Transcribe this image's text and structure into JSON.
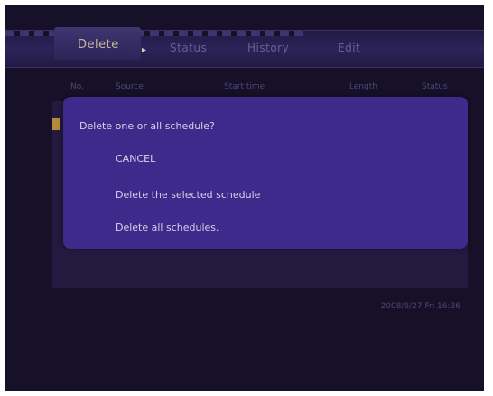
{
  "tabs": [
    {
      "label": "Delete",
      "active": true
    },
    {
      "label": "Status"
    },
    {
      "label": "History"
    },
    {
      "label": "Edit"
    }
  ],
  "columns": [
    "No.",
    "Source",
    "Start time",
    "Length",
    "Status"
  ],
  "dialog": {
    "title": "Delete one or all schedule?",
    "options": [
      "CANCEL",
      "Delete the selected schedule",
      "Delete all schedules."
    ]
  },
  "status": {
    "datetime": "2008/6/27 Fri 16:36"
  },
  "colors": {
    "background": "#161129",
    "dialog": "#3d2a8a",
    "marker": "#b48a3c"
  }
}
